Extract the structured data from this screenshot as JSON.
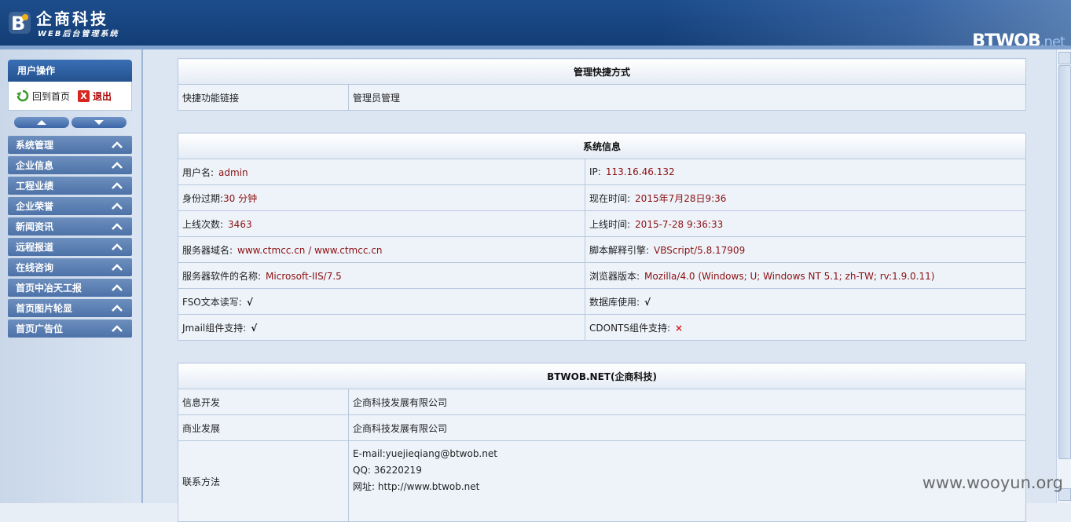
{
  "header": {
    "title": "企商科技",
    "subtitle": "WEB后台管理系统",
    "brand": "BTWOB",
    "brand_suffix": ".net"
  },
  "sidebar": {
    "user_box_title": "用户操作",
    "home_label": "回到首页",
    "exit_label": "退出",
    "menu": [
      {
        "label": "系统管理"
      },
      {
        "label": "企业信息"
      },
      {
        "label": "工程业绩"
      },
      {
        "label": "企业荣誉"
      },
      {
        "label": "新闻资讯"
      },
      {
        "label": "远程报道"
      },
      {
        "label": "在线咨询"
      },
      {
        "label": "首页中冶天工报"
      },
      {
        "label": "首页图片轮显"
      },
      {
        "label": "首页广告位"
      }
    ]
  },
  "quick": {
    "title": "管理快捷方式",
    "label": "快捷功能链接",
    "link": "管理员管理"
  },
  "sysinfo": {
    "title": "系统信息",
    "rows": [
      {
        "l_label": "用户名:",
        "l_value": "admin",
        "r_label": "IP:",
        "r_value": "113.16.46.132"
      },
      {
        "l_label": "身份过期:",
        "l_value": "30 分钟",
        "r_label": "现在时间:",
        "r_value": "2015年7月28日9:36"
      },
      {
        "l_label": "上线次数:",
        "l_value": "3463",
        "r_label": "上线时间:",
        "r_value": "2015-7-28 9:36:33"
      },
      {
        "l_label": "服务器域名:",
        "l_value": "www.ctmcc.cn / www.ctmcc.cn",
        "r_label": "脚本解释引擎:",
        "r_value": "VBScript/5.8.17909"
      },
      {
        "l_label": "服务器软件的名称:",
        "l_value": "Microsoft-IIS/7.5",
        "r_label": "浏览器版本:",
        "r_value": "Mozilla/4.0 (Windows; U; Windows NT 5.1; zh-TW; rv:1.9.0.11)"
      },
      {
        "l_label": "FSO文本读写:",
        "l_value": "√",
        "r_label": "数据库使用:",
        "r_value": "√"
      },
      {
        "l_label": "Jmail组件支持:",
        "l_value": "√",
        "r_label": "CDONTS组件支持:",
        "r_value": "×"
      }
    ]
  },
  "about": {
    "title": "BTWOB.NET(企商科技)",
    "rows": [
      {
        "label": "信息开发",
        "value": "企商科技发展有限公司"
      },
      {
        "label": "商业发展",
        "value": "企商科技发展有限公司"
      }
    ],
    "contact_label": "联系方法",
    "contact_lines": [
      "E-mail:yuejieqiang@btwob.net",
      "QQ: 36220219",
      "网址: http://www.btwob.net"
    ]
  },
  "watermark": "www.wooyun.org",
  "colors": {
    "header": "#1d4d8c",
    "menu": "#5a7db0",
    "value": "#8b1010",
    "cross": "#d21c1c"
  }
}
